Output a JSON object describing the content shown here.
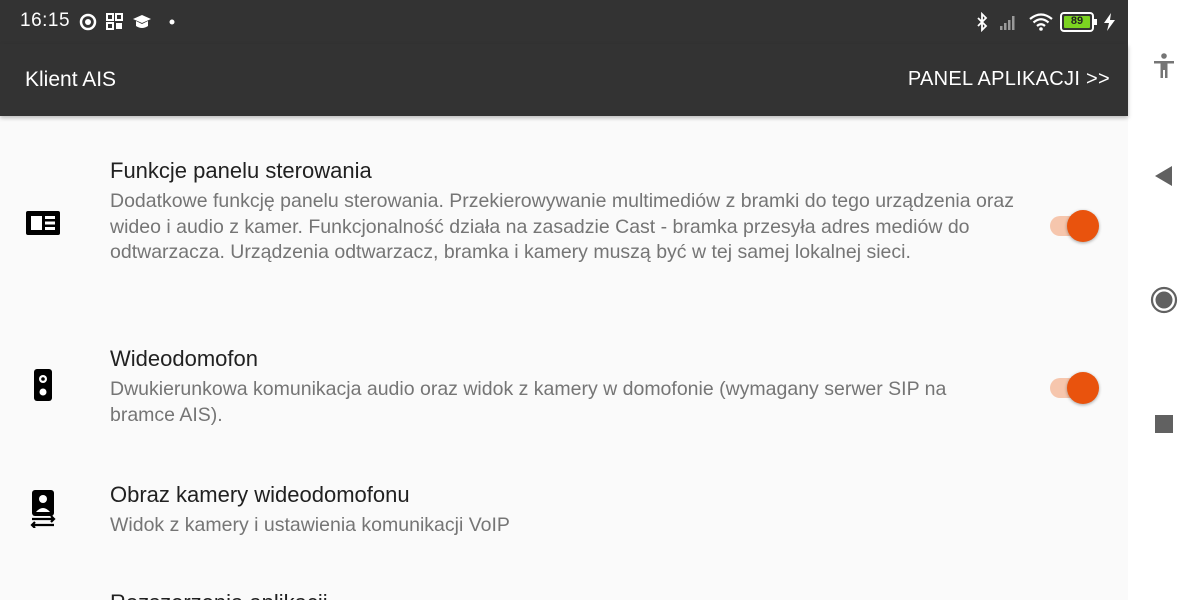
{
  "status_bar": {
    "time": "16:15",
    "battery_level": "89",
    "icons": [
      "sync-icon",
      "apps-grid-icon",
      "graduation-cap-icon",
      "notification-dot-icon",
      "bluetooth-icon",
      "signal-icon",
      "wifi-icon",
      "battery-icon",
      "charging-icon"
    ]
  },
  "app_bar": {
    "title": "Klient AIS",
    "panel_button_label": "PANEL APLIKACJI >>"
  },
  "preferences": [
    {
      "title": "Funkcje panelu sterowania",
      "summary": "Dodatkowe funkcję panelu sterowania. Przekierowywanie multimediów z bramki do tego urządzenia oraz wideo i audio z kamer. Funkcjonalność działa na zasadzie Cast - bramka przesyła adres mediów do odtwarzacza. Urządzenia odtwarzacz, bramka i kamery muszą być w tej samej lokalnej sieci.",
      "icon": "dashboard-card-icon",
      "switch_on": true
    },
    {
      "title": "Wideodomofon",
      "summary": "Dwukierunkowa komunikacja audio oraz widok z kamery w domofonie (wymagany serwer SIP na bramce AIS).",
      "icon": "intercom-icon",
      "switch_on": true
    },
    {
      "title": "Obraz kamery wideodomofonu",
      "summary": "Widok z kamery i ustawienia komunikacji VoIP",
      "icon": "camera-intercom-icon"
    },
    {
      "title": "Rozszerzenia aplikacji",
      "icon": "extension-icon"
    }
  ],
  "colors": {
    "bar_background": "#333333",
    "accent": "#e9530d",
    "switch_track": "#f6c6ad",
    "content_background": "#fafafa",
    "title_text": "#212121",
    "summary_text": "#757575"
  },
  "nav_bar": {
    "buttons": [
      "accessibility-icon",
      "back-icon",
      "home-icon",
      "recents-icon"
    ]
  }
}
